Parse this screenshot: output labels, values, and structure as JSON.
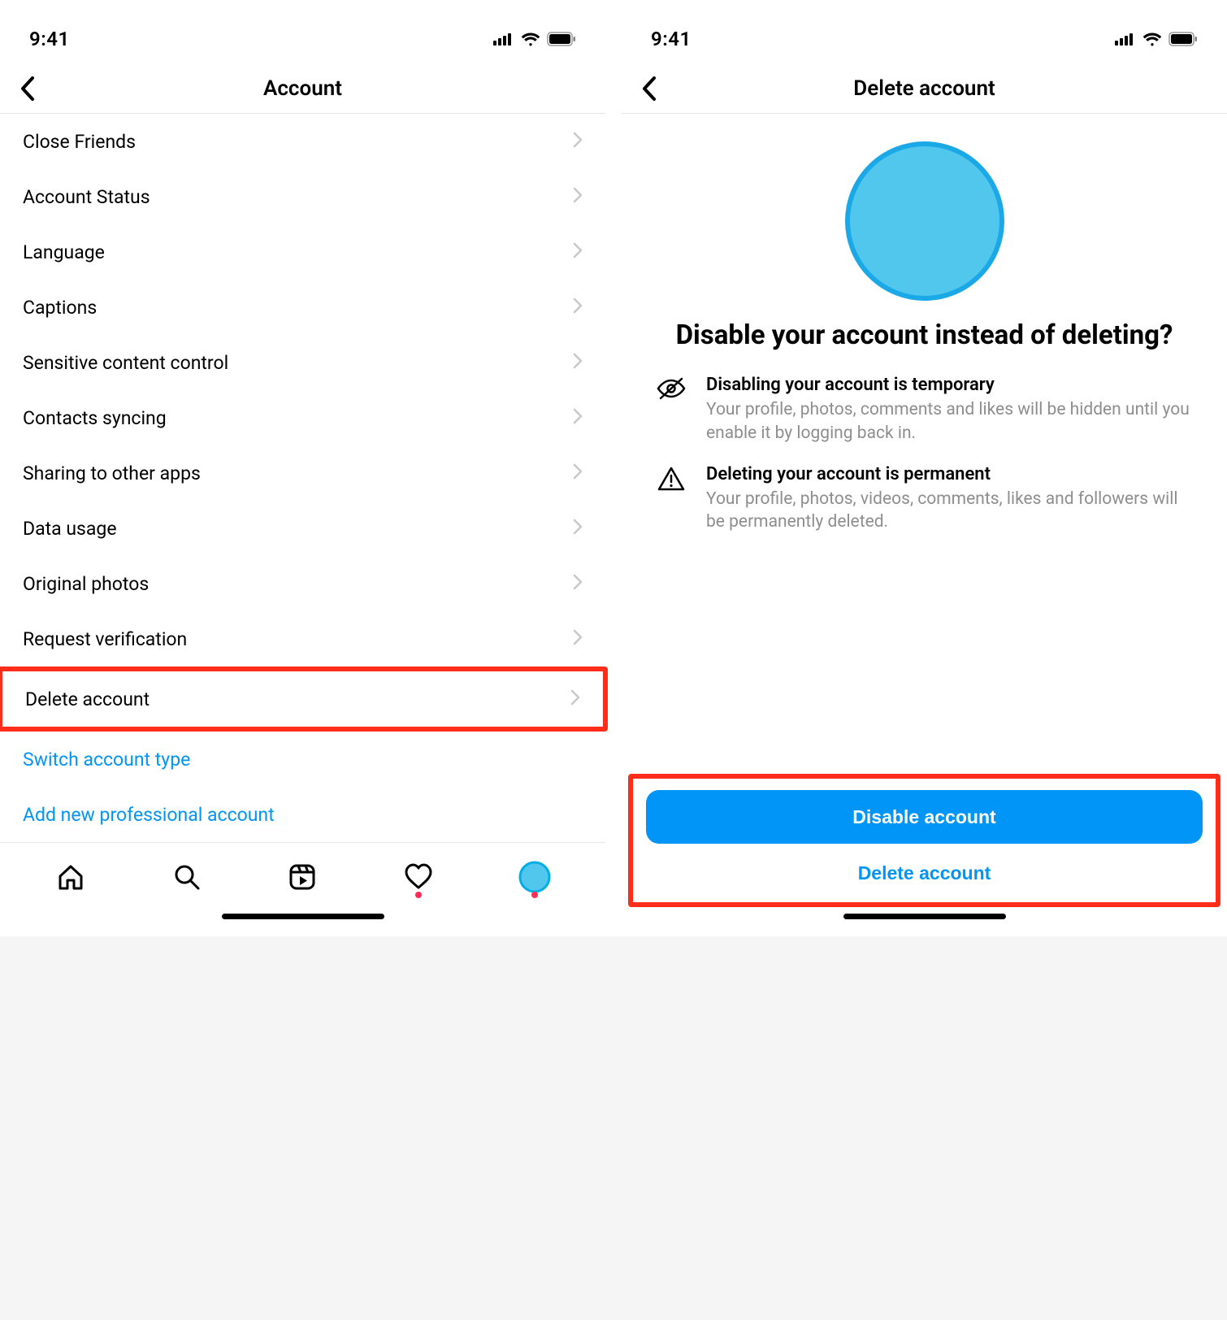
{
  "status": {
    "time": "9:41"
  },
  "left": {
    "title": "Account",
    "items": [
      {
        "label": "Close Friends"
      },
      {
        "label": "Account Status"
      },
      {
        "label": "Language"
      },
      {
        "label": "Captions"
      },
      {
        "label": "Sensitive content control"
      },
      {
        "label": "Contacts syncing"
      },
      {
        "label": "Sharing to other apps"
      },
      {
        "label": "Data usage"
      },
      {
        "label": "Original photos"
      },
      {
        "label": "Request verification"
      },
      {
        "label": "Delete account"
      }
    ],
    "links": [
      {
        "label": "Switch account type"
      },
      {
        "label": "Add new professional account"
      }
    ]
  },
  "right": {
    "title": "Delete account",
    "headline": "Disable your account instead of deleting?",
    "points": [
      {
        "title": "Disabling your account is temporary",
        "desc": "Your profile, photos, comments and likes will be hidden until you enable it by logging back in."
      },
      {
        "title": "Deleting your account is permanent",
        "desc": "Your profile, photos, videos, comments, likes and followers will be permanently deleted."
      }
    ],
    "primary_button": "Disable account",
    "secondary_button": "Delete account"
  }
}
